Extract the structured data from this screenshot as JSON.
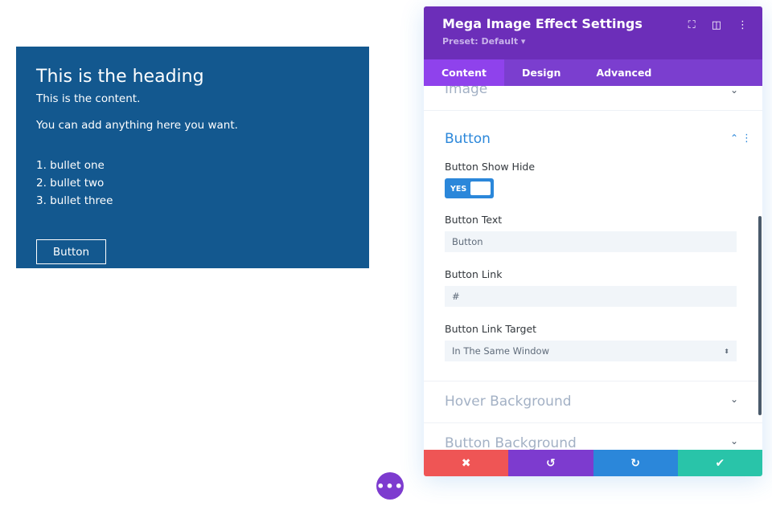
{
  "module": {
    "heading": "This is the heading",
    "content1": "This is the content.",
    "content2": "You can add anything here you want.",
    "bullets": [
      "1. bullet one",
      "2. bullet two",
      "3. bullet three"
    ],
    "button": "Button"
  },
  "panel": {
    "title": "Mega Image Effect Settings",
    "preset": "Preset: Default ▾",
    "tabs": [
      "Content",
      "Design",
      "Advanced"
    ],
    "sections": {
      "image": "Image",
      "button": "Button",
      "hover_bg": "Hover Background",
      "button_bg": "Button Background"
    },
    "fields": {
      "show_hide_label": "Button Show Hide",
      "toggle": "YES",
      "text_label": "Button Text",
      "text_value": "Button",
      "link_label": "Button Link",
      "link_value": "#",
      "target_label": "Button Link Target",
      "target_value": "In The Same Window"
    }
  },
  "colors": {
    "module_bg": "#13588f",
    "header": "#6c2eb9",
    "cancel": "#ef5555",
    "undo": "#7d3bcf",
    "redo": "#2b87da",
    "save": "#29c4a9"
  }
}
